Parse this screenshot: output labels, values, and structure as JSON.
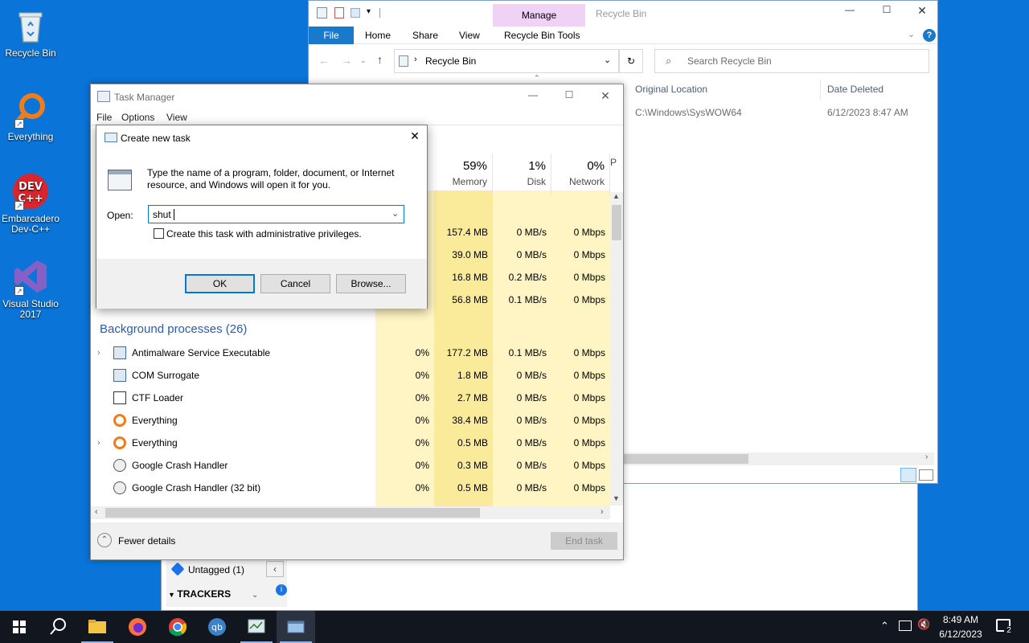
{
  "desktop": {
    "icons": [
      {
        "label": "Recycle Bin"
      },
      {
        "label": "Everything"
      },
      {
        "label": "Embarcadero Dev-C++"
      },
      {
        "label": "Visual Studio 2017"
      }
    ]
  },
  "explorer": {
    "title": "Recycle Bin",
    "manage_tab": "Manage",
    "ribbon_tabs": [
      "File",
      "Home",
      "Share",
      "View",
      "Recycle Bin Tools"
    ],
    "address": "Recycle Bin",
    "search_placeholder": "Search Recycle Bin",
    "columns": [
      "Original Location",
      "Date Deleted"
    ],
    "item": {
      "location": "C:\\Windows\\SysWOW64",
      "date": "6/12/2023 8:47 AM"
    }
  },
  "background_app": {
    "untagged": "Untagged (1)",
    "trackers": "TRACKERS"
  },
  "task_manager": {
    "title": "Task Manager",
    "menu": [
      "File",
      "Options",
      "View"
    ],
    "columns": [
      {
        "pct": "59%",
        "label": "Memory"
      },
      {
        "pct": "1%",
        "label": "Disk"
      },
      {
        "pct": "0%",
        "label": "Network"
      },
      {
        "pct": "",
        "label": "P"
      }
    ],
    "top_rows": [
      {
        "mem": "157.4 MB",
        "disk": "0 MB/s",
        "net": "0 Mbps"
      },
      {
        "mem": "39.0 MB",
        "disk": "0 MB/s",
        "net": "0 Mbps"
      },
      {
        "mem": "16.8 MB",
        "disk": "0.2 MB/s",
        "net": "0 Mbps"
      },
      {
        "mem": "56.8 MB",
        "disk": "0.1 MB/s",
        "net": "0 Mbps"
      }
    ],
    "section": "Background processes (26)",
    "processes": [
      {
        "name": "Antimalware Service Executable",
        "cpu": "0%",
        "mem": "177.2 MB",
        "disk": "0.1 MB/s",
        "net": "0 Mbps"
      },
      {
        "name": "COM Surrogate",
        "cpu": "0%",
        "mem": "1.8 MB",
        "disk": "0 MB/s",
        "net": "0 Mbps"
      },
      {
        "name": "CTF Loader",
        "cpu": "0%",
        "mem": "2.7 MB",
        "disk": "0 MB/s",
        "net": "0 Mbps"
      },
      {
        "name": "Everything",
        "cpu": "0%",
        "mem": "38.4 MB",
        "disk": "0 MB/s",
        "net": "0 Mbps"
      },
      {
        "name": "Everything",
        "cpu": "0%",
        "mem": "0.5 MB",
        "disk": "0 MB/s",
        "net": "0 Mbps"
      },
      {
        "name": "Google Crash Handler",
        "cpu": "0%",
        "mem": "0.3 MB",
        "disk": "0 MB/s",
        "net": "0 Mbps"
      },
      {
        "name": "Google Crash Handler (32 bit)",
        "cpu": "0%",
        "mem": "0.5 MB",
        "disk": "0 MB/s",
        "net": "0 Mbps"
      }
    ],
    "fewer_details": "Fewer details",
    "end_task": "End task"
  },
  "dialog": {
    "title": "Create new task",
    "description": "Type the name of a program, folder, document, or Internet resource, and Windows will open it for you.",
    "open_label": "Open:",
    "open_value": "shut",
    "admin_checkbox": "Create this task with administrative privileges.",
    "ok": "OK",
    "cancel": "Cancel",
    "browse": "Browse..."
  },
  "taskbar": {
    "time": "8:49 AM",
    "date": "6/12/2023",
    "notification_count": "2"
  }
}
